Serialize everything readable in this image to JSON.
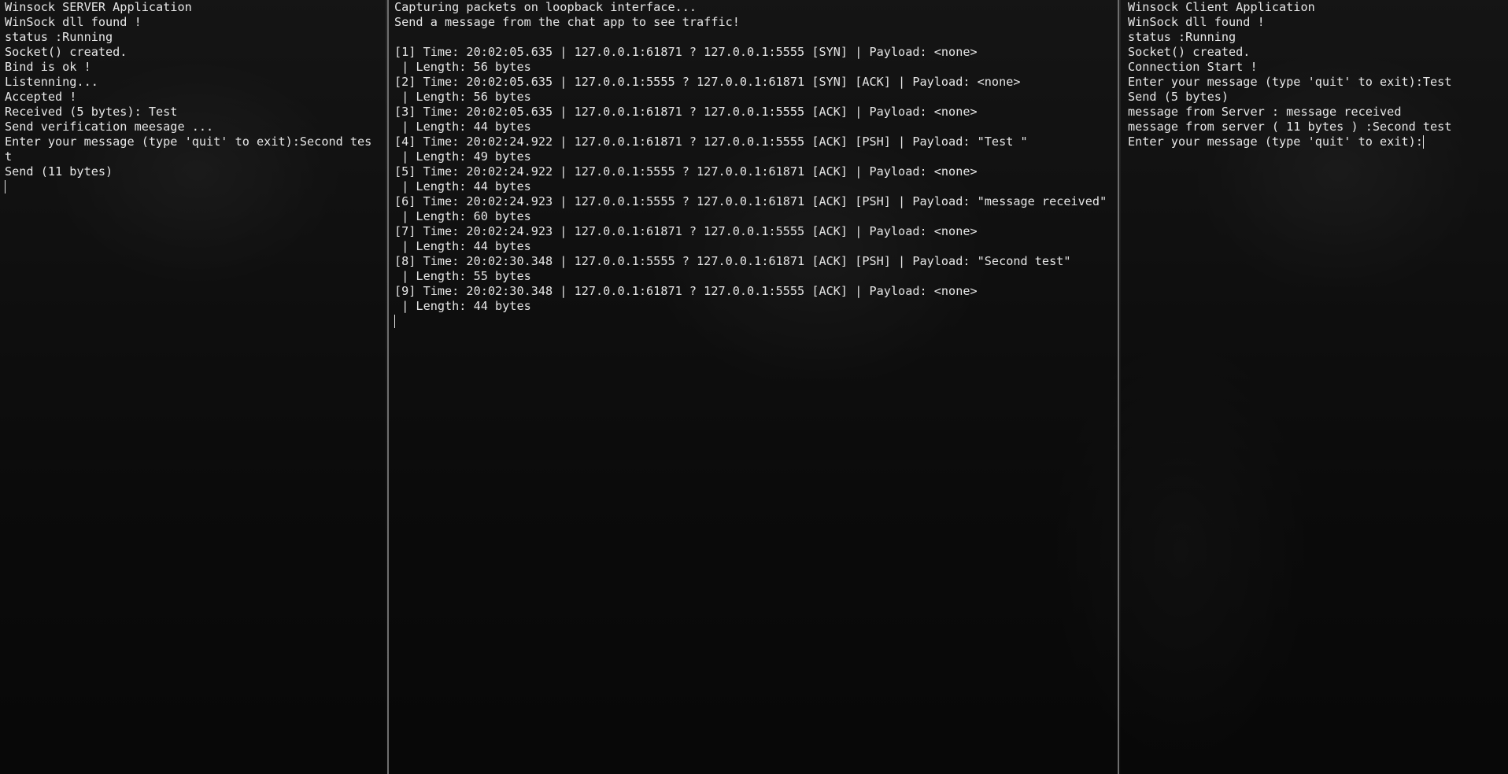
{
  "colors": {
    "background": "#0c0c0c",
    "text": "#e6e6e6",
    "pane_divider": "#6e6e6e"
  },
  "server_pane": {
    "lines": [
      "Winsock SERVER Application",
      "WinSock dll found !",
      "status :Running",
      "Socket() created.",
      "Bind is ok !",
      "Listenning...",
      "Accepted !",
      "Received (5 bytes): Test",
      "Send verification meesage ...",
      "Enter your message (type 'quit' to exit):Second tes",
      "t",
      "Send (11 bytes)"
    ]
  },
  "sniffer_pane": {
    "lines": [
      "Capturing packets on loopback interface...",
      "Send a message from the chat app to see traffic!",
      "",
      "[1] Time: 20:02:05.635 | 127.0.0.1:61871 ? 127.0.0.1:5555 [SYN] | Payload: <none>",
      " | Length: 56 bytes",
      "[2] Time: 20:02:05.635 | 127.0.0.1:5555 ? 127.0.0.1:61871 [SYN] [ACK] | Payload: <none>",
      " | Length: 56 bytes",
      "[3] Time: 20:02:05.635 | 127.0.0.1:61871 ? 127.0.0.1:5555 [ACK] | Payload: <none>",
      " | Length: 44 bytes",
      "[4] Time: 20:02:24.922 | 127.0.0.1:61871 ? 127.0.0.1:5555 [ACK] [PSH] | Payload: \"Test \"",
      " | Length: 49 bytes",
      "[5] Time: 20:02:24.922 | 127.0.0.1:5555 ? 127.0.0.1:61871 [ACK] | Payload: <none>",
      " | Length: 44 bytes",
      "[6] Time: 20:02:24.923 | 127.0.0.1:5555 ? 127.0.0.1:61871 [ACK] [PSH] | Payload: \"message received\"",
      " | Length: 60 bytes",
      "[7] Time: 20:02:24.923 | 127.0.0.1:61871 ? 127.0.0.1:5555 [ACK] | Payload: <none>",
      " | Length: 44 bytes",
      "[8] Time: 20:02:30.348 | 127.0.0.1:5555 ? 127.0.0.1:61871 [ACK] [PSH] | Payload: \"Second test\"",
      " | Length: 55 bytes",
      "[9] Time: 20:02:30.348 | 127.0.0.1:61871 ? 127.0.0.1:5555 [ACK] | Payload: <none>",
      " | Length: 44 bytes"
    ]
  },
  "client_pane": {
    "lines": [
      "Winsock Client Application",
      "WinSock dll found !",
      "status :Running",
      "Socket() created.",
      "Connection Start !",
      "Enter your message (type 'quit' to exit):Test",
      "Send (5 bytes)",
      "message from Server : message received",
      "message from server ( 11 bytes ) :Second test",
      "Enter your message (type 'quit' to exit):"
    ]
  }
}
